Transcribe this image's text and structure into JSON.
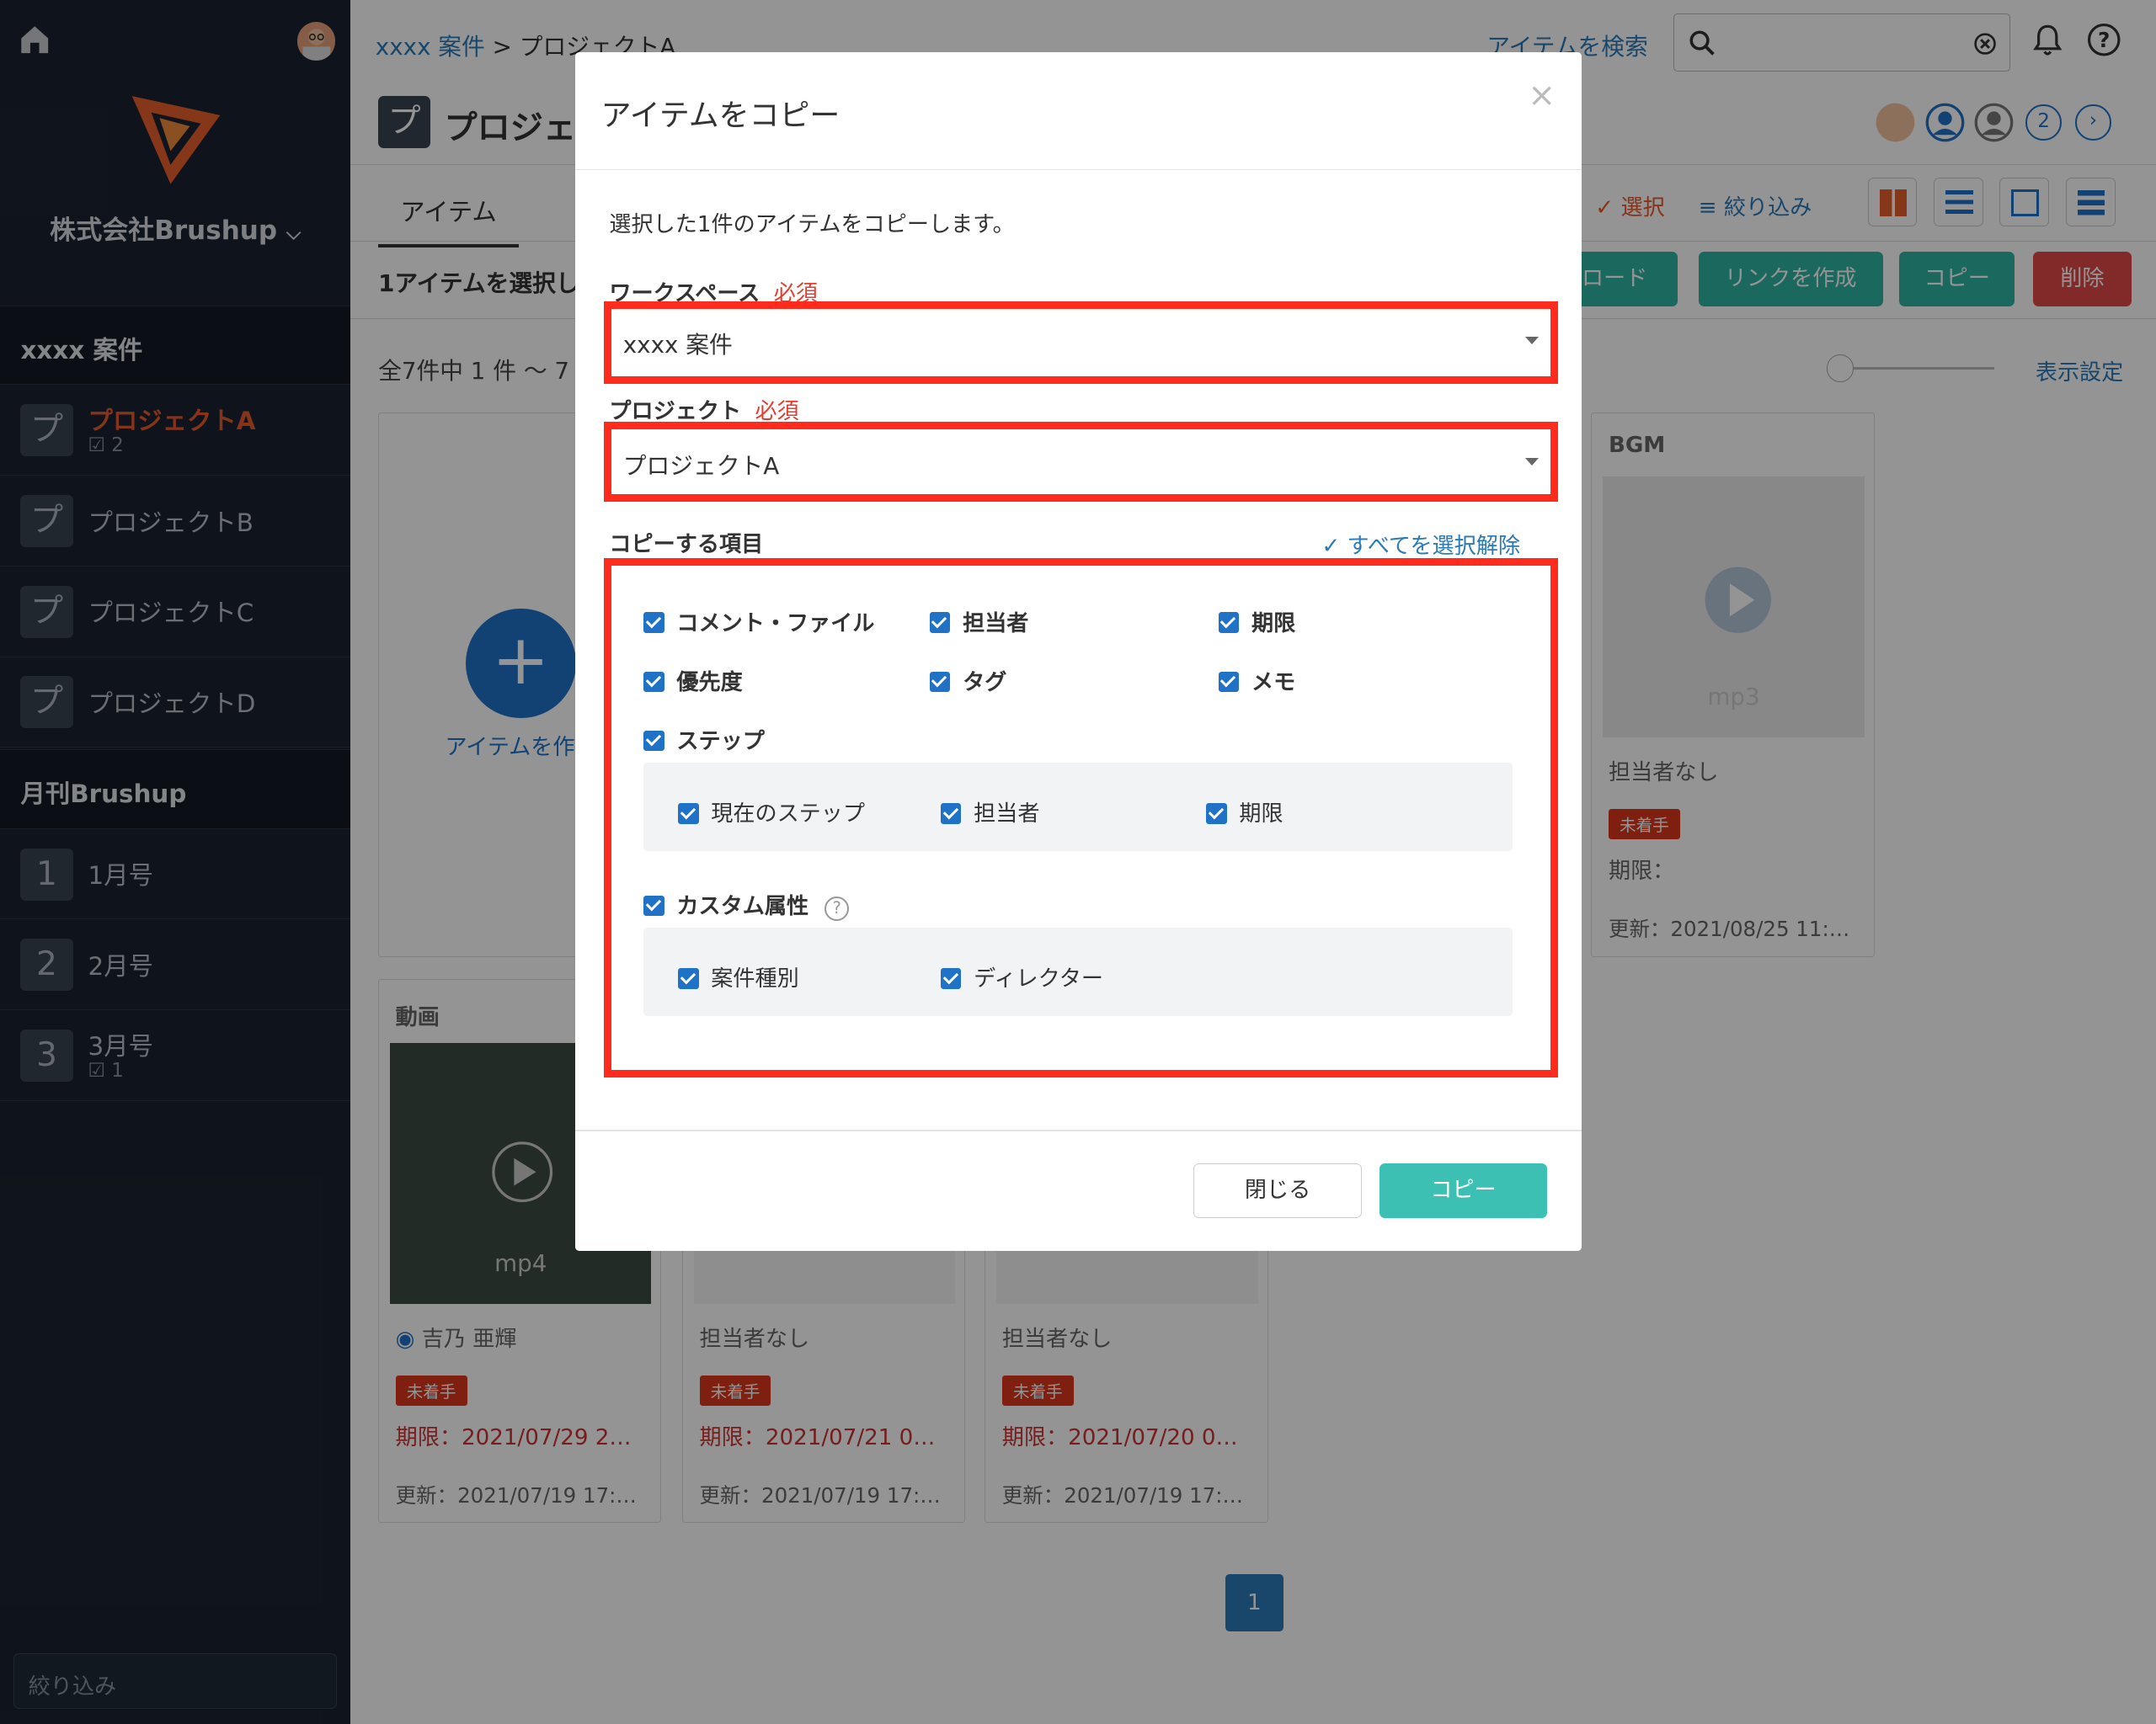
{
  "sidebar": {
    "company": "株式会社Brushup",
    "sections": [
      {
        "title": "xxxx 案件",
        "items": [
          {
            "icon": "プ",
            "label": "プロジェクトA",
            "count": "2"
          },
          {
            "icon": "プ",
            "label": "プロジェクトB"
          },
          {
            "icon": "プ",
            "label": "プロジェクトC"
          },
          {
            "icon": "プ",
            "label": "プロジェクトD"
          }
        ]
      },
      {
        "title": "月刊Brushup",
        "items": [
          {
            "icon": "1",
            "label": "1月号"
          },
          {
            "icon": "2",
            "label": "2月号"
          },
          {
            "icon": "3",
            "label": "3月号",
            "count": "1"
          }
        ]
      }
    ],
    "filter_placeholder": "絞り込み"
  },
  "header": {
    "breadcrumb_workspace": "xxxx 案件",
    "breadcrumb_sep": ">",
    "breadcrumb_project": "プロジェクトA",
    "search_link": "アイテムを検索",
    "member_count": "2"
  },
  "project": {
    "icon": "プ",
    "title": "プロジェクトA",
    "tab": "アイテム",
    "selection": "1アイテムを選択し",
    "select_label": "選択",
    "filter_label": "絞り込み",
    "buttons": {
      "download": "ロード",
      "link": "リンクを作成",
      "copy": "コピー",
      "delete": "削除"
    },
    "count_text": "全7件中 1 件 〜 7",
    "display_settings": "表示設定",
    "create_item": "アイテムを作",
    "page": "1"
  },
  "cards": [
    {
      "title": "BGM",
      "ext": "mp3",
      "assignee": "担当者なし",
      "status": "未着手",
      "deadline": "期限：",
      "updated": "更新：2021/08/25 11:…"
    },
    {
      "title": "動画",
      "ext": "mp4",
      "assignee": "吉乃 亜輝",
      "status": "未着手",
      "deadline": "期限：2021/07/29 2…",
      "updated": "更新：2021/07/19 17:…"
    },
    {
      "title": "",
      "assignee": "担当者なし",
      "status": "未着手",
      "deadline": "期限：2021/07/21 0…",
      "updated": "更新：2021/07/19 17:…"
    },
    {
      "title": "",
      "assignee": "担当者なし",
      "status": "未着手",
      "deadline": "期限：2021/07/20 0…",
      "updated": "更新：2021/07/19 17:…"
    }
  ],
  "modal": {
    "title": "アイテムをコピー",
    "close_icon": "×",
    "description": "選択した1件のアイテムをコピーします。",
    "workspace_label": "ワークスペース",
    "workspace_value": "xxxx 案件",
    "project_label": "プロジェクト",
    "project_value": "プロジェクトA",
    "required": "必須",
    "items_label": "コピーする項目",
    "unselect_all": "すべてを選択解除",
    "options": {
      "comment_file": "コメント・ファイル",
      "assignee": "担当者",
      "deadline": "期限",
      "priority": "優先度",
      "tag": "タグ",
      "memo": "メモ",
      "step": "ステップ",
      "current_step": "現在のステップ",
      "step_assignee": "担当者",
      "step_deadline": "期限",
      "custom_attr": "カスタム属性",
      "case_type": "案件種別",
      "director": "ディレクター"
    },
    "close_button": "閉じる",
    "copy_button": "コピー"
  },
  "colors": {
    "accent": "#1f72c6",
    "highlight": "#ff2b1c",
    "copy": "#3cc0b4",
    "danger": "#e04848",
    "teal": "#2fb3a3"
  }
}
